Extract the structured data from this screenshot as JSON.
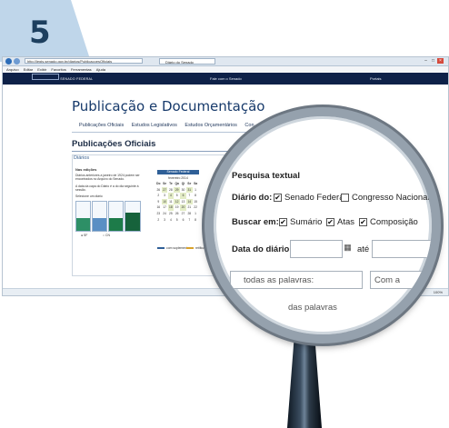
{
  "step": {
    "number": "5"
  },
  "browser": {
    "url": "http://legis.senado.gov.br/diarios/PublicacoesOficiais",
    "tab_title": "Diário do Senado",
    "menu": [
      "Arquivo",
      "Editar",
      "Exibir",
      "Favoritos",
      "Ferramentas",
      "Ajuda"
    ],
    "zoom": "100%"
  },
  "site": {
    "logo_text": "SENADO FEDERAL",
    "center_link": "Fale com o Senado",
    "right_link": "Portais"
  },
  "page": {
    "title": "Publicação e Documentação",
    "subnav": [
      "Publicações Oficiais",
      "Estudos Legislativos",
      "Estudos Orçamentários",
      "Con"
    ],
    "section_title": "Publicações Oficiais",
    "panel_title": "Diários",
    "left_col": {
      "heading": "Nas edições",
      "text": "Diários anteriores a janeiro de 1924 podem ser encontrados no Arquivo do Senado.",
      "note": "A data da capa do Diário é a do dia seguinte à sessão.",
      "select_label": "Selecione um diário",
      "radio_sf": "SF",
      "radio_cn": "CN"
    },
    "calendar": {
      "header": "Senado Federal",
      "month": "fevereiro 2014",
      "weekdays": [
        "Do",
        "Se",
        "Te",
        "Qa",
        "Qi",
        "Se",
        "Sa"
      ],
      "days": [
        [
          "26",
          "27",
          "28",
          "29",
          "30",
          "31",
          "1"
        ],
        [
          "2",
          "3",
          "4",
          "5",
          "6",
          "7",
          "8"
        ],
        [
          "9",
          "10",
          "11",
          "12",
          "13",
          "14",
          "15"
        ],
        [
          "16",
          "17",
          "18",
          "19",
          "20",
          "21",
          "22"
        ],
        [
          "23",
          "24",
          "25",
          "26",
          "27",
          "28",
          "1"
        ],
        [
          "2",
          "3",
          "4",
          "5",
          "6",
          "7",
          "8"
        ]
      ],
      "legend_with_supplement": "com suplemento",
      "legend_edited": "retificação"
    }
  },
  "search": {
    "heading": "Pesquisa textual",
    "diario_label": "Diário do:",
    "senado_label": "Senado Federal",
    "senado_checked": true,
    "congresso_label": "Congresso Nacional",
    "congresso_checked": false,
    "buscar_label": "Buscar em:",
    "sumario_label": "Sumário",
    "sumario_checked": true,
    "atas_label": "Atas",
    "atas_checked": true,
    "composicao_label": "Composição",
    "composicao_checked": true,
    "date_label": "Data do diário:",
    "ate_label": "até",
    "all_words_placeholder": "todas as palavras:",
    "with_placeholder": "Com a",
    "more_words": "das palavras"
  },
  "colors": {
    "navy": "#0e2148",
    "title_blue": "#173a6b",
    "step_tab": "#bfd6ea"
  }
}
